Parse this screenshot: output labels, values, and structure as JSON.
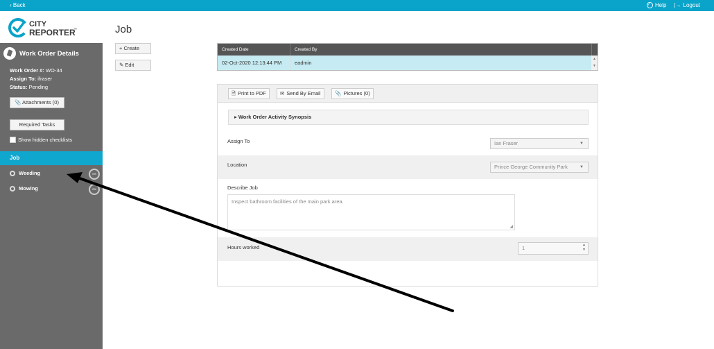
{
  "topbar": {
    "back_label": "Back",
    "help_label": "Help",
    "logout_label": "Logout"
  },
  "logo": {
    "line1": "CITY",
    "line2": "REPORTER",
    "tm": "™",
    "colors": {
      "blue": "#0aa3c9",
      "dark": "#3a3a3a"
    }
  },
  "sidebar": {
    "title": "Work Order Details",
    "work_order_label": "Work Order #:",
    "work_order_value": "WO-34",
    "assign_label": "Assign To:",
    "assign_value": "ifraser",
    "status_label": "Status:",
    "status_value": "Pending",
    "attachments_label": "Attachments (0)",
    "required_tasks_label": "Required Tasks",
    "show_hidden_label": "Show hidden checklists",
    "nav": {
      "job": "Job",
      "weeding": "Weeding",
      "weeding_pct": "0%",
      "mowing": "Mowing",
      "mowing_pct": "0%"
    }
  },
  "main": {
    "page_title": "Job",
    "create_label": "Create",
    "edit_label": "Edit",
    "grid": {
      "headers": [
        "Created Date",
        "Created By"
      ],
      "row": [
        "02-Oct-2020 12:13:44 PM",
        "eadmin"
      ]
    },
    "toolbar": {
      "pdf_label": "Print to PDF",
      "email_label": "Send By Email",
      "pictures_label": "Pictures (0)"
    },
    "synopsis_label": "Work Order Activity Synopsis",
    "fields": {
      "assign_label": "Assign To",
      "assign_value": "Ian Fraser",
      "location_label": "Location",
      "location_value": "Prince George Community Park",
      "describe_label": "Describe Job",
      "describe_value": "Inspect bathroom facilities of the main park area.",
      "hours_label": "Hours worked",
      "hours_value": "1"
    }
  },
  "accent": "#0aa3c9"
}
